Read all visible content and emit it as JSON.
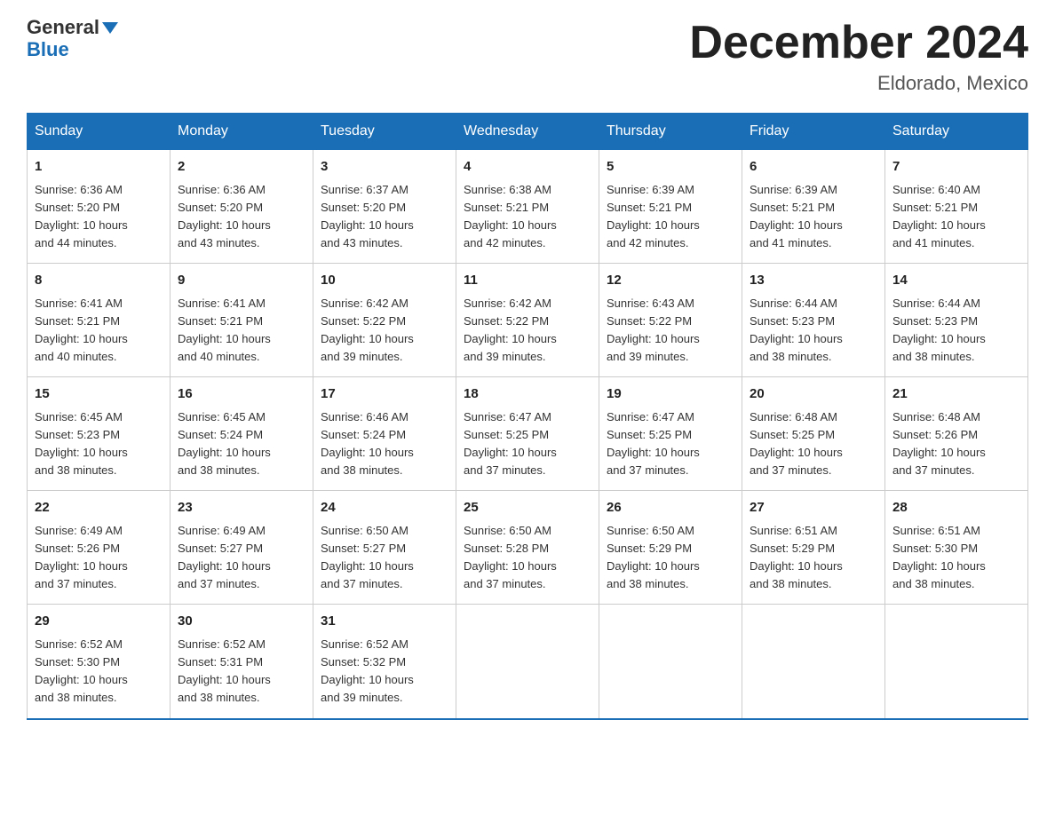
{
  "header": {
    "logo_line1": "General",
    "logo_line2": "Blue",
    "month_title": "December 2024",
    "location": "Eldorado, Mexico"
  },
  "days_of_week": [
    "Sunday",
    "Monday",
    "Tuesday",
    "Wednesday",
    "Thursday",
    "Friday",
    "Saturday"
  ],
  "weeks": [
    [
      {
        "day": "1",
        "sunrise": "6:36 AM",
        "sunset": "5:20 PM",
        "daylight": "10 hours and 44 minutes."
      },
      {
        "day": "2",
        "sunrise": "6:36 AM",
        "sunset": "5:20 PM",
        "daylight": "10 hours and 43 minutes."
      },
      {
        "day": "3",
        "sunrise": "6:37 AM",
        "sunset": "5:20 PM",
        "daylight": "10 hours and 43 minutes."
      },
      {
        "day": "4",
        "sunrise": "6:38 AM",
        "sunset": "5:21 PM",
        "daylight": "10 hours and 42 minutes."
      },
      {
        "day": "5",
        "sunrise": "6:39 AM",
        "sunset": "5:21 PM",
        "daylight": "10 hours and 42 minutes."
      },
      {
        "day": "6",
        "sunrise": "6:39 AM",
        "sunset": "5:21 PM",
        "daylight": "10 hours and 41 minutes."
      },
      {
        "day": "7",
        "sunrise": "6:40 AM",
        "sunset": "5:21 PM",
        "daylight": "10 hours and 41 minutes."
      }
    ],
    [
      {
        "day": "8",
        "sunrise": "6:41 AM",
        "sunset": "5:21 PM",
        "daylight": "10 hours and 40 minutes."
      },
      {
        "day": "9",
        "sunrise": "6:41 AM",
        "sunset": "5:21 PM",
        "daylight": "10 hours and 40 minutes."
      },
      {
        "day": "10",
        "sunrise": "6:42 AM",
        "sunset": "5:22 PM",
        "daylight": "10 hours and 39 minutes."
      },
      {
        "day": "11",
        "sunrise": "6:42 AM",
        "sunset": "5:22 PM",
        "daylight": "10 hours and 39 minutes."
      },
      {
        "day": "12",
        "sunrise": "6:43 AM",
        "sunset": "5:22 PM",
        "daylight": "10 hours and 39 minutes."
      },
      {
        "day": "13",
        "sunrise": "6:44 AM",
        "sunset": "5:23 PM",
        "daylight": "10 hours and 38 minutes."
      },
      {
        "day": "14",
        "sunrise": "6:44 AM",
        "sunset": "5:23 PM",
        "daylight": "10 hours and 38 minutes."
      }
    ],
    [
      {
        "day": "15",
        "sunrise": "6:45 AM",
        "sunset": "5:23 PM",
        "daylight": "10 hours and 38 minutes."
      },
      {
        "day": "16",
        "sunrise": "6:45 AM",
        "sunset": "5:24 PM",
        "daylight": "10 hours and 38 minutes."
      },
      {
        "day": "17",
        "sunrise": "6:46 AM",
        "sunset": "5:24 PM",
        "daylight": "10 hours and 38 minutes."
      },
      {
        "day": "18",
        "sunrise": "6:47 AM",
        "sunset": "5:25 PM",
        "daylight": "10 hours and 37 minutes."
      },
      {
        "day": "19",
        "sunrise": "6:47 AM",
        "sunset": "5:25 PM",
        "daylight": "10 hours and 37 minutes."
      },
      {
        "day": "20",
        "sunrise": "6:48 AM",
        "sunset": "5:25 PM",
        "daylight": "10 hours and 37 minutes."
      },
      {
        "day": "21",
        "sunrise": "6:48 AM",
        "sunset": "5:26 PM",
        "daylight": "10 hours and 37 minutes."
      }
    ],
    [
      {
        "day": "22",
        "sunrise": "6:49 AM",
        "sunset": "5:26 PM",
        "daylight": "10 hours and 37 minutes."
      },
      {
        "day": "23",
        "sunrise": "6:49 AM",
        "sunset": "5:27 PM",
        "daylight": "10 hours and 37 minutes."
      },
      {
        "day": "24",
        "sunrise": "6:50 AM",
        "sunset": "5:27 PM",
        "daylight": "10 hours and 37 minutes."
      },
      {
        "day": "25",
        "sunrise": "6:50 AM",
        "sunset": "5:28 PM",
        "daylight": "10 hours and 37 minutes."
      },
      {
        "day": "26",
        "sunrise": "6:50 AM",
        "sunset": "5:29 PM",
        "daylight": "10 hours and 38 minutes."
      },
      {
        "day": "27",
        "sunrise": "6:51 AM",
        "sunset": "5:29 PM",
        "daylight": "10 hours and 38 minutes."
      },
      {
        "day": "28",
        "sunrise": "6:51 AM",
        "sunset": "5:30 PM",
        "daylight": "10 hours and 38 minutes."
      }
    ],
    [
      {
        "day": "29",
        "sunrise": "6:52 AM",
        "sunset": "5:30 PM",
        "daylight": "10 hours and 38 minutes."
      },
      {
        "day": "30",
        "sunrise": "6:52 AM",
        "sunset": "5:31 PM",
        "daylight": "10 hours and 38 minutes."
      },
      {
        "day": "31",
        "sunrise": "6:52 AM",
        "sunset": "5:32 PM",
        "daylight": "10 hours and 39 minutes."
      },
      null,
      null,
      null,
      null
    ]
  ],
  "labels": {
    "sunrise": "Sunrise:",
    "sunset": "Sunset:",
    "daylight": "Daylight:"
  }
}
